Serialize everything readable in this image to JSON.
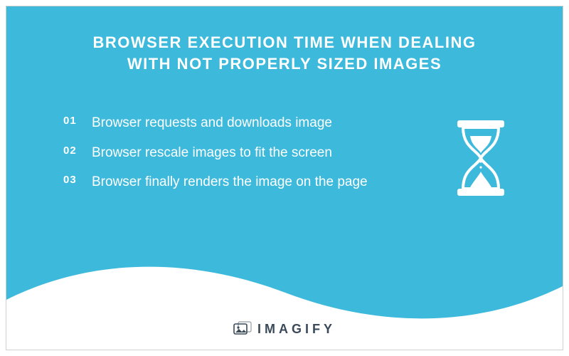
{
  "title": "BROWSER EXECUTION TIME WHEN DEALING WITH NOT PROPERLY SIZED IMAGES",
  "steps": [
    {
      "num": "01",
      "text": "Browser requests and downloads image"
    },
    {
      "num": "02",
      "text": "Browser rescale images to fit the screen"
    },
    {
      "num": "03",
      "text": "Browser finally renders the image on the page"
    }
  ],
  "brand": "IMAGIFY",
  "colors": {
    "bg": "#3db9dc",
    "text": "#ffffff",
    "brand": "#3a4a5a"
  }
}
